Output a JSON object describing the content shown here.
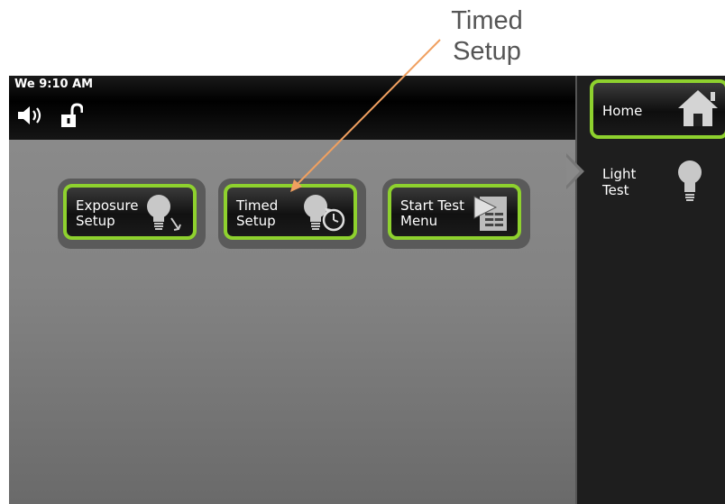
{
  "annotation": {
    "line1": "Timed",
    "line2": "Setup",
    "arrow_color": "#f0a060"
  },
  "status": {
    "clock": "We 9:10 AM",
    "icons": [
      "speaker-icon",
      "unlocked-padlock-icon"
    ]
  },
  "tiles": [
    {
      "line1": "Exposure",
      "line2": "Setup",
      "icon": "lightbulb-arrow-icon"
    },
    {
      "line1": "Timed",
      "line2": "Setup",
      "icon": "lightbulb-timer-icon"
    },
    {
      "line1": "Start Test",
      "line2": "Menu",
      "icon": "play-list-icon"
    }
  ],
  "sidebar": {
    "home_label": "Home",
    "home_icon": "house-icon",
    "current_line1": "Light",
    "current_line2": "Test",
    "current_icon": "lightbulb-icon"
  },
  "colors": {
    "accent_green": "#8ed12e",
    "panel_bg": "#1e1e1e"
  }
}
